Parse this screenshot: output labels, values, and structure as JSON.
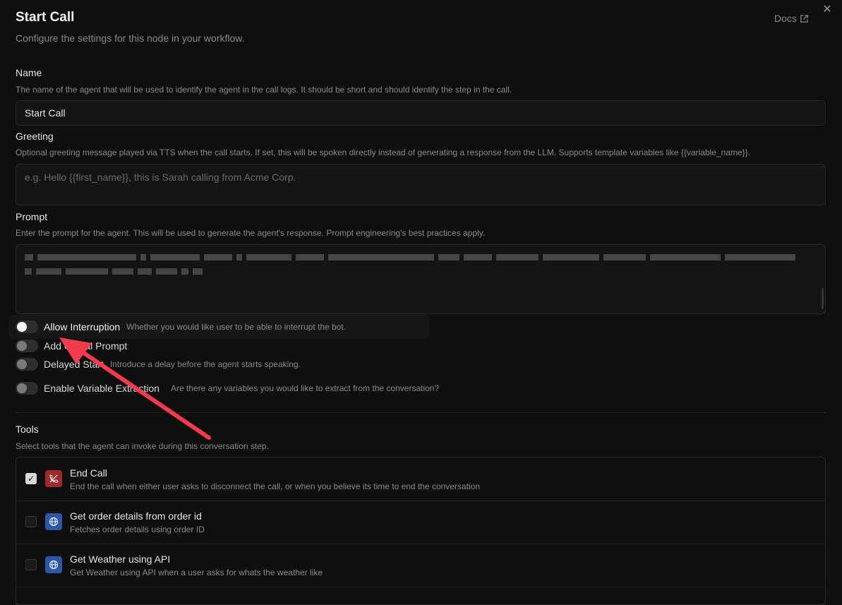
{
  "header": {
    "title": "Start Call",
    "subtitle": "Configure the settings for this node in your workflow.",
    "docs_label": "Docs",
    "close_symbol": "✕"
  },
  "name": {
    "label": "Name",
    "hint": "The name of the agent that will be used to identify the agent in the call logs. It should be short and should identify the step in the call.",
    "value": "Start Call"
  },
  "greeting": {
    "label": "Greeting",
    "hint": "Optional greeting message played via TTS when the call starts. If set, this will be spoken directly instead of generating a response from the LLM. Supports template variables like {{variable_name}}.",
    "placeholder": "e.g. Hello {{first_name}}, this is Sarah calling from Acme Corp."
  },
  "prompt": {
    "label": "Prompt",
    "hint": "Enter the prompt for the agent. This will be used to generate the agent's response. Prompt engineering's best practices apply."
  },
  "toggles": [
    {
      "label": "Allow Interruption",
      "desc": "Whether you would like user to be able to interrupt the bot.",
      "on": false
    },
    {
      "label": "Add Global Prompt",
      "desc": "",
      "on": false
    },
    {
      "label": "Delayed Start",
      "desc": "Introduce a delay before the agent starts speaking.",
      "on": false
    },
    {
      "label": "Enable Variable Extraction",
      "desc": "Are there any variables you would like to extract from the conversation?",
      "on": false
    }
  ],
  "tools": {
    "label": "Tools",
    "hint": "Select tools that the agent can invoke during this conversation step.",
    "items": [
      {
        "name": "End Call",
        "desc": "End the call when either user asks to disconnect the call, or when you believe its time to end the conversation",
        "checked": true,
        "icon": "phone-off-icon",
        "color": "#9e2a2a"
      },
      {
        "name": "Get order details from order id",
        "desc": "Fetches order details using order ID",
        "checked": false,
        "icon": "globe-icon",
        "color": "#2d58a8"
      },
      {
        "name": "Get Weather using API",
        "desc": "Get Weather using API when a user asks for whats the weather like",
        "checked": false,
        "icon": "globe-icon",
        "color": "#2d58a8"
      }
    ]
  },
  "colors": {
    "annotation_arrow": "#f23b4c",
    "background": "#0f0f0f"
  }
}
